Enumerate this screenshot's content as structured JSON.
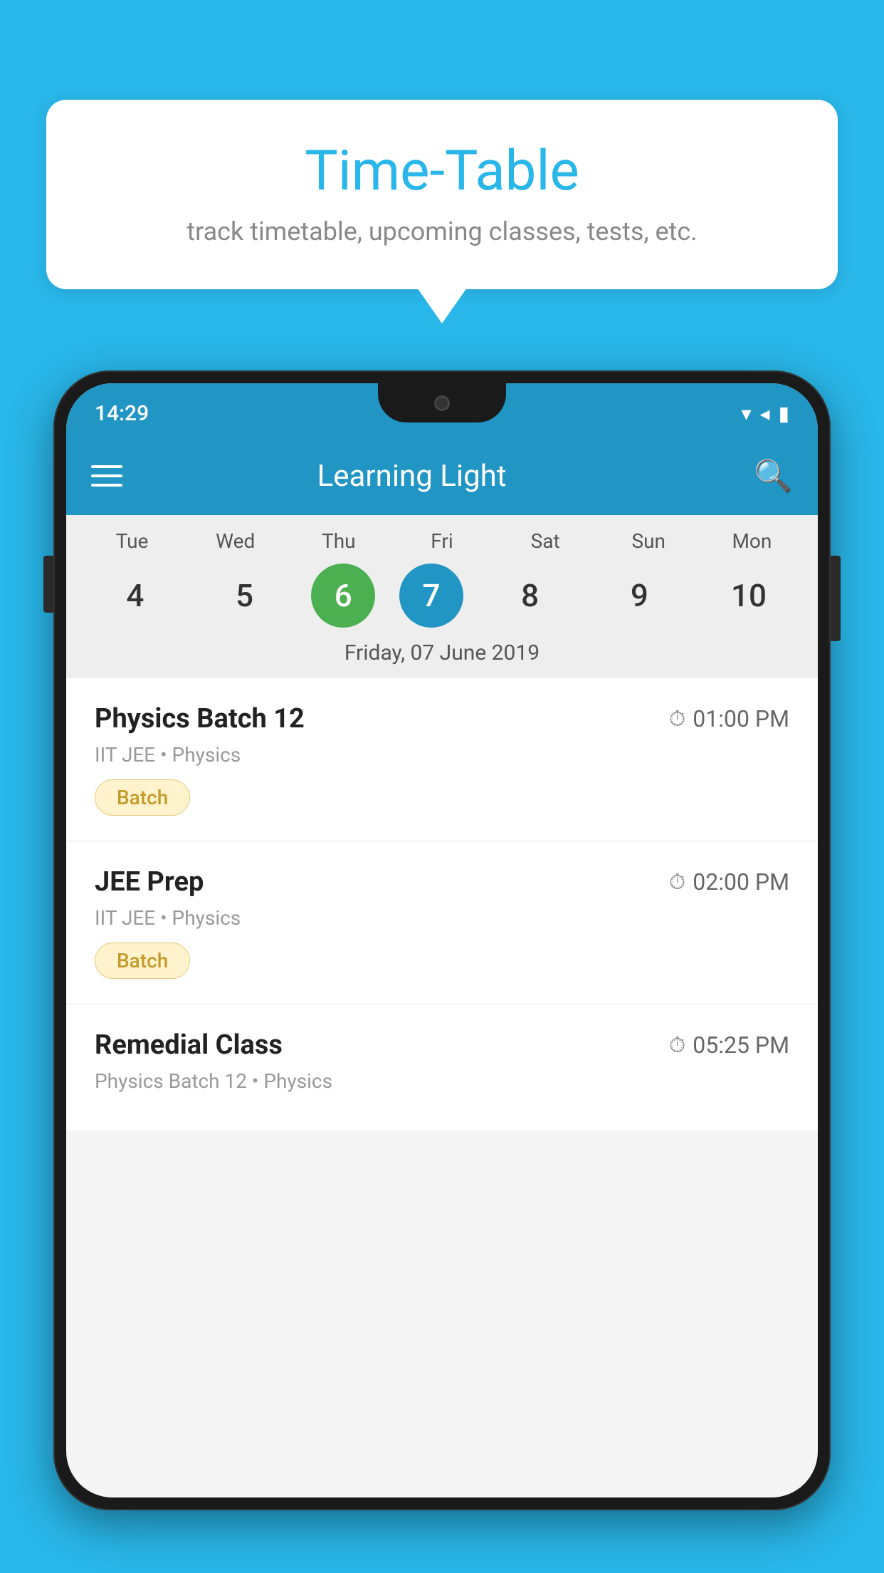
{
  "background_color": "#29b6e8",
  "bubble": {
    "title": "Time-Table",
    "subtitle": "track timetable, upcoming classes, tests, etc."
  },
  "phone": {
    "status_bar": {
      "time": "14:29"
    },
    "app_bar": {
      "title": "Learning Light"
    },
    "calendar": {
      "days": [
        {
          "label": "Tue",
          "num": "4",
          "state": "normal"
        },
        {
          "label": "Wed",
          "num": "5",
          "state": "normal"
        },
        {
          "label": "Thu",
          "num": "6",
          "state": "today"
        },
        {
          "label": "Fri",
          "num": "7",
          "state": "selected"
        },
        {
          "label": "Sat",
          "num": "8",
          "state": "normal"
        },
        {
          "label": "Sun",
          "num": "9",
          "state": "normal"
        },
        {
          "label": "Mon",
          "num": "10",
          "state": "normal"
        }
      ],
      "selected_date_label": "Friday, 07 June 2019"
    },
    "schedule": [
      {
        "title": "Physics Batch 12",
        "time": "01:00 PM",
        "subtitle": "IIT JEE • Physics",
        "badge": "Batch"
      },
      {
        "title": "JEE Prep",
        "time": "02:00 PM",
        "subtitle": "IIT JEE • Physics",
        "badge": "Batch"
      },
      {
        "title": "Remedial Class",
        "time": "05:25 PM",
        "subtitle": "Physics Batch 12 • Physics",
        "badge": null
      }
    ]
  }
}
